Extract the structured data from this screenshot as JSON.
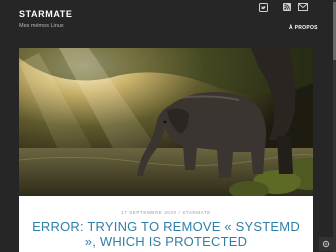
{
  "header": {
    "site_title": "STARMATE",
    "tagline": "Mes mémos Linux",
    "nav": [
      {
        "label": "À PROPOS"
      }
    ],
    "social": [
      "twitter-icon",
      "rss-icon",
      "mail-icon"
    ]
  },
  "post": {
    "date": "17 SEPTEMBRE 2020",
    "separator": "/",
    "category": "STARMATE",
    "title": "ERROR: TRYING TO REMOVE « SYSTEMD », WHICH IS PROTECTED"
  },
  "colors": {
    "background": "#262626",
    "link_accent": "#2f7fa6",
    "card": "#ffffff"
  }
}
